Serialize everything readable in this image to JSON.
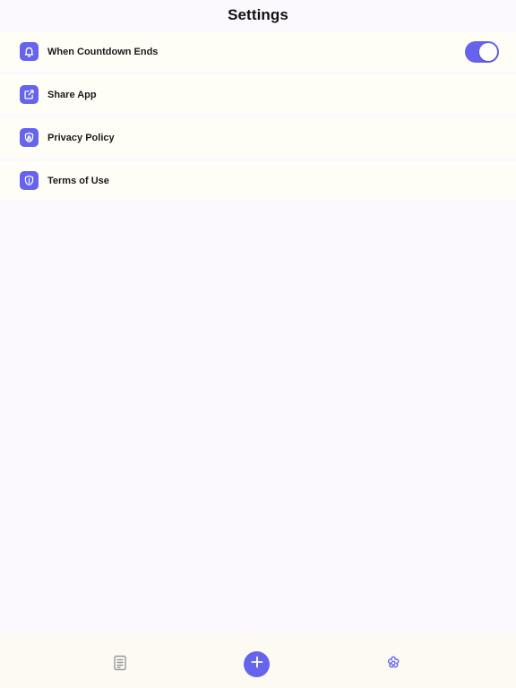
{
  "header": {
    "title": "Settings"
  },
  "settings": {
    "items": [
      {
        "label": "When Countdown Ends",
        "icon": "bell-icon",
        "toggle_on": true
      },
      {
        "label": "Share App",
        "icon": "share-icon"
      },
      {
        "label": "Privacy Policy",
        "icon": "privacy-shield-icon"
      },
      {
        "label": "Terms of Use",
        "icon": "terms-shield-icon"
      }
    ]
  },
  "tab_bar": {
    "tabs": [
      {
        "icon": "document-list-icon"
      },
      {
        "icon": "plus-icon"
      },
      {
        "icon": "flower-gear-icon"
      }
    ]
  },
  "colors": {
    "accent": "#6664ee",
    "background": "#fcf9fe",
    "row_background": "#fefef6",
    "tab_icon_inactive": "#9a9a9a",
    "tab_icon_active": "#6664ee"
  }
}
